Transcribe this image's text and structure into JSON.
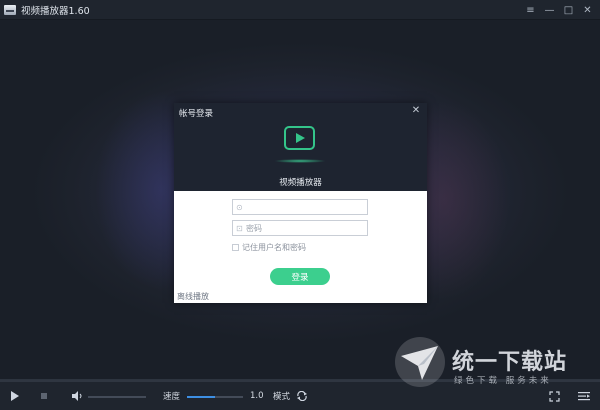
{
  "window": {
    "title": "视频播放器1.60",
    "controls": [
      "≡",
      "—",
      "□",
      "✕"
    ]
  },
  "dialog": {
    "title": "帐号登录",
    "brand": "视频播放器",
    "username_placeholder": "",
    "password_placeholder": "密码",
    "remember_label": "记住用户名和密码",
    "login_button": "登录",
    "offline_link": "离线播放"
  },
  "controlbar": {
    "speed_label": "速度",
    "speed_value": "1.0",
    "mode_label": "模式",
    "speed_fraction": 0.5,
    "volume_fraction": 0.0
  },
  "watermark": {
    "title": "统一下载站",
    "subtitle": "绿色下载  服务未来"
  },
  "colors": {
    "accent_green": "#3ccf8e",
    "slider_blue": "#3d8fe3",
    "background": "#1b2029"
  }
}
